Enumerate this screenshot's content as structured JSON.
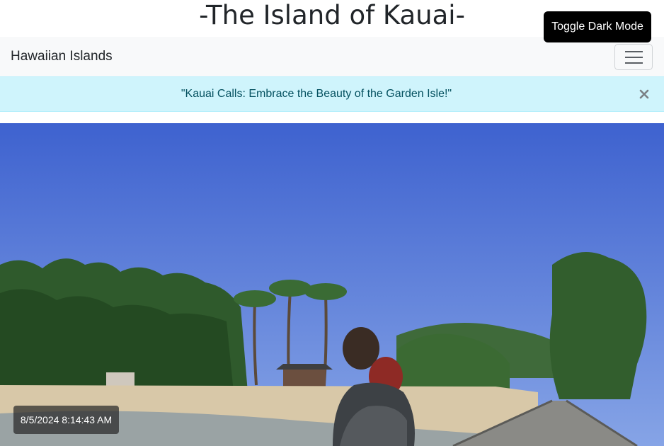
{
  "page": {
    "title": "-The Island of Kauai-"
  },
  "controls": {
    "toggle_dark_mode": "Toggle Dark Mode"
  },
  "navbar": {
    "brand": "Hawaiian Islands",
    "toggler_icon": "hamburger-icon"
  },
  "alert": {
    "message": "\"Kauai Calls: Embrace the Beauty of the Garden Isle!\"",
    "close_icon": "close-icon"
  },
  "photo": {
    "timestamp": "8/5/2024 8:14:43 AM"
  },
  "colors": {
    "navbar_bg": "#f8f9fa",
    "alert_bg": "#cff4fc",
    "alert_text": "#055160",
    "toggle_btn_bg": "#000000",
    "sky": "#4a6fd4"
  }
}
